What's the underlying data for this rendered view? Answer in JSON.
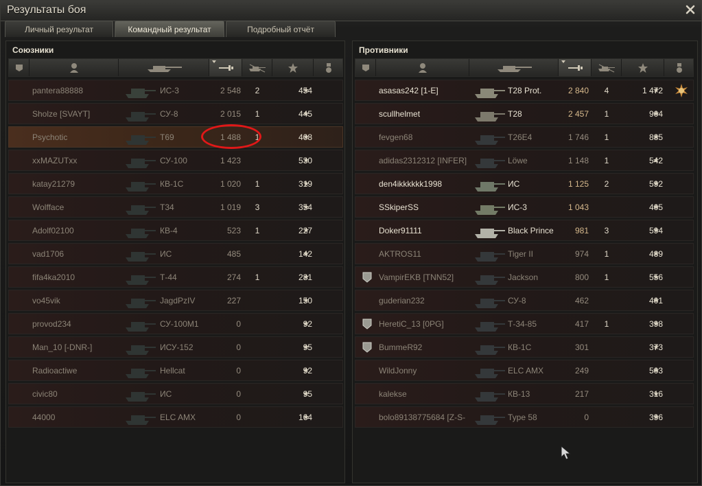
{
  "window": {
    "title": "Результаты боя"
  },
  "tabs": [
    {
      "label": "Личный результат",
      "active": false
    },
    {
      "label": "Командный результат",
      "active": true
    },
    {
      "label": "Подробный отчёт",
      "active": false
    }
  ],
  "columns": [
    "squad-icon",
    "player-icon",
    "tank-icon",
    "damage-icon",
    "frags-icon",
    "xp-star-icon",
    "medal-icon"
  ],
  "sorted_column": "damage",
  "allies": {
    "title": "Союзники",
    "rows": [
      {
        "name": "pantera88888",
        "tank": "ИС-3",
        "damage": "2 548",
        "frags": "2",
        "xp": "454",
        "alive": false,
        "player": false
      },
      {
        "name": "Sholze [SVAYT]",
        "tank": "СУ-8",
        "damage": "2 015",
        "frags": "1",
        "xp": "445",
        "alive": false,
        "player": false
      },
      {
        "name": "Psychotic",
        "tank": "T69",
        "damage": "1 488",
        "frags": "1",
        "xp": "408",
        "alive": false,
        "player": true
      },
      {
        "name": "xxMAZUTxx",
        "tank": "СУ-100",
        "damage": "1 423",
        "frags": "",
        "xp": "530",
        "alive": false,
        "player": false
      },
      {
        "name": "katay21279",
        "tank": "КВ-1С",
        "damage": "1 020",
        "frags": "1",
        "xp": "319",
        "alive": false,
        "player": false
      },
      {
        "name": "Wolfface",
        "tank": "Т34",
        "damage": "1 019",
        "frags": "3",
        "xp": "354",
        "alive": false,
        "player": false
      },
      {
        "name": "Adolf02100",
        "tank": "КВ-4",
        "damage": "523",
        "frags": "1",
        "xp": "227",
        "alive": false,
        "player": false
      },
      {
        "name": "vad1706",
        "tank": "ИС",
        "damage": "485",
        "frags": "",
        "xp": "142",
        "alive": false,
        "player": false
      },
      {
        "name": "fifa4ka2010",
        "tank": "Т-44",
        "damage": "274",
        "frags": "1",
        "xp": "281",
        "alive": false,
        "player": false
      },
      {
        "name": "vo45vik",
        "tank": "JagdPzIV",
        "damage": "227",
        "frags": "",
        "xp": "150",
        "alive": false,
        "player": false
      },
      {
        "name": "provod234",
        "tank": "СУ-100М1",
        "damage": "0",
        "frags": "",
        "xp": "92",
        "alive": false,
        "player": false
      },
      {
        "name": "Man_10 [-DNR-]",
        "tank": "ИСУ-152",
        "damage": "0",
        "frags": "",
        "xp": "95",
        "alive": false,
        "player": false
      },
      {
        "name": "Radioactiwe",
        "tank": "Hellcat",
        "damage": "0",
        "frags": "",
        "xp": "92",
        "alive": false,
        "player": false
      },
      {
        "name": "civic80",
        "tank": "ИС",
        "damage": "0",
        "frags": "",
        "xp": "95",
        "alive": false,
        "player": false
      },
      {
        "name": "44000",
        "tank": "ELC AMX",
        "damage": "0",
        "frags": "",
        "xp": "164",
        "alive": false,
        "player": false
      }
    ]
  },
  "enemies": {
    "title": "Противники",
    "rows": [
      {
        "name": "asasas242 [1-E]",
        "tank": "T28 Prot.",
        "damage": "2 840",
        "frags": "4",
        "xp": "1 472",
        "alive": true,
        "medal": true,
        "squad": false
      },
      {
        "name": "scullhelmet",
        "tank": "T28",
        "damage": "2 457",
        "frags": "1",
        "xp": "904",
        "alive": true,
        "medal": false,
        "squad": false
      },
      {
        "name": "fevgen68",
        "tank": "T26E4",
        "damage": "1 746",
        "frags": "1",
        "xp": "885",
        "alive": false,
        "medal": false,
        "squad": false
      },
      {
        "name": "adidas2312312 [INFER]",
        "tank": "Löwe",
        "damage": "1 148",
        "frags": "1",
        "xp": "542",
        "alive": false,
        "medal": false,
        "squad": false
      },
      {
        "name": "den4ikkkkkk1998",
        "tank": "ИС",
        "damage": "1 125",
        "frags": "2",
        "xp": "592",
        "alive": true,
        "medal": false,
        "squad": false
      },
      {
        "name": "SSkiperSS",
        "tank": "ИС-3",
        "damage": "1 043",
        "frags": "",
        "xp": "405",
        "alive": true,
        "medal": false,
        "squad": false
      },
      {
        "name": "Doker91111",
        "tank": "Black Prince",
        "damage": "981",
        "frags": "3",
        "xp": "594",
        "alive": true,
        "medal": false,
        "squad": false
      },
      {
        "name": "AKTROS11",
        "tank": "Tiger II",
        "damage": "974",
        "frags": "1",
        "xp": "489",
        "alive": false,
        "medal": false,
        "squad": false
      },
      {
        "name": "VampirEKB [TNN52]",
        "tank": "Jackson",
        "damage": "800",
        "frags": "1",
        "xp": "556",
        "alive": false,
        "medal": false,
        "squad": true
      },
      {
        "name": "guderian232",
        "tank": "СУ-8",
        "damage": "462",
        "frags": "",
        "xp": "401",
        "alive": false,
        "medal": false,
        "squad": false
      },
      {
        "name": "HeretiC_13 [0PG]",
        "tank": "Т-34-85",
        "damage": "417",
        "frags": "1",
        "xp": "398",
        "alive": false,
        "medal": false,
        "squad": true
      },
      {
        "name": "BummeR92",
        "tank": "КВ-1С",
        "damage": "301",
        "frags": "",
        "xp": "373",
        "alive": false,
        "medal": false,
        "squad": true
      },
      {
        "name": "WildJonny",
        "tank": "ELC AMX",
        "damage": "249",
        "frags": "",
        "xp": "503",
        "alive": false,
        "medal": false,
        "squad": false
      },
      {
        "name": "kalekse",
        "tank": "КВ-13",
        "damage": "217",
        "frags": "",
        "xp": "316",
        "alive": false,
        "medal": false,
        "squad": false
      },
      {
        "name": "bolo89138775684 [Z-S-",
        "tank": "Type 58",
        "damage": "0",
        "frags": "",
        "xp": "396",
        "alive": false,
        "medal": false,
        "squad": false
      }
    ]
  },
  "annotation": {
    "shape": "ellipse",
    "color": "#e01818",
    "target": "Psychotic damage"
  },
  "colors": {
    "alive_text": "#e8e2d2",
    "dead_text": "#8c8477",
    "player_row": "#4a2e1e",
    "highlight": "#e01818"
  }
}
